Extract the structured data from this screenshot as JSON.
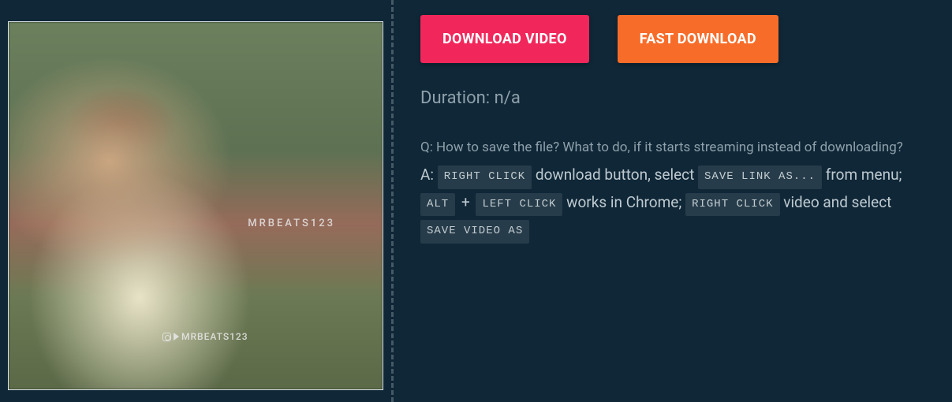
{
  "actions": {
    "download_label": "DOWNLOAD VIDEO",
    "fast_download_label": "FAST DOWNLOAD"
  },
  "meta": {
    "duration_label": "Duration: n/a"
  },
  "thumbnail": {
    "watermark_top": "MRBEATS123",
    "watermark_bottom": "MRBEATS123"
  },
  "faq": {
    "question": "Q: How to save the file? What to do, if it starts streaming instead of downloading?",
    "answer": {
      "prefix": "A:",
      "kbd_right_click": "RIGHT CLICK",
      "text1": " download button, select ",
      "kbd_save_link_as": "SAVE LINK AS...",
      "text2": " from menu;",
      "kbd_alt": "ALT",
      "plus": "+",
      "kbd_left_click": "LEFT CLICK",
      "text3": " works in Chrome; ",
      "kbd_right_click2": "RIGHT CLICK",
      "text4": " video and select ",
      "kbd_save_video_as": "SAVE VIDEO AS"
    }
  }
}
